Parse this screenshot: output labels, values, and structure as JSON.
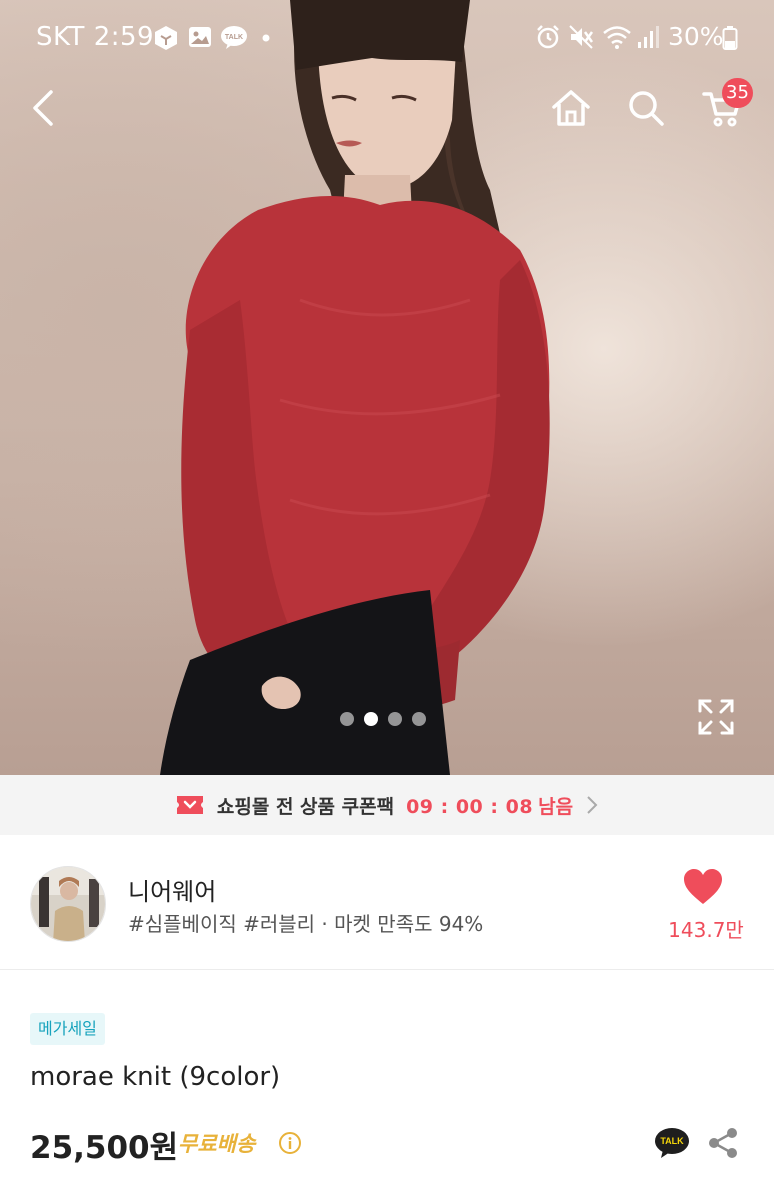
{
  "status_bar": {
    "carrier": "SKT",
    "time": "2:59",
    "notification_icons": [
      "box-icon",
      "gallery-icon",
      "talk-icon"
    ],
    "system_icons": [
      "alarm-icon",
      "mute-icon",
      "wifi-icon",
      "signal-icon"
    ],
    "battery": "30%",
    "talk_label": "TALK"
  },
  "nav": {
    "cart_count": "35"
  },
  "carousel": {
    "count": 4,
    "active_index": 1
  },
  "coupon": {
    "text": "쇼핑몰 전 상품 쿠폰팩",
    "timer": "09 : 00 : 08",
    "suffix": "남음"
  },
  "shop": {
    "name": "니어웨어",
    "description": "#심플베이직 #러블리 · 마켓 만족도 94%",
    "likes": "143.7만"
  },
  "product": {
    "sale_tag": "메가세일",
    "name": "morae knit (9color)",
    "price": "25,500원",
    "shipping": "무료배송",
    "talk_label": "TALK"
  },
  "colors": {
    "accent_red": "#ef4d5b",
    "sale_teal": "#18a3bd",
    "shipping_gold": "#e8b23a"
  }
}
